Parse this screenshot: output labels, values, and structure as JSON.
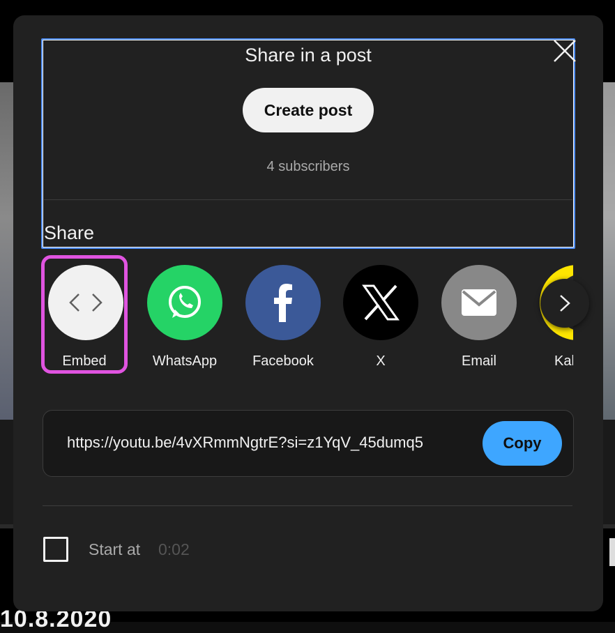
{
  "background": {
    "date_fragment": "10.8.2020"
  },
  "dialog": {
    "post_section": {
      "title": "Share in a post",
      "create_post_label": "Create post",
      "subscribers": "4 subscribers"
    },
    "share_heading": "Share",
    "share_targets": [
      {
        "label": "Embed",
        "icon": "embed-code-icon",
        "color": "#f1f1f1",
        "selected": true
      },
      {
        "label": "WhatsApp",
        "icon": "whatsapp-icon",
        "color": "#25d366"
      },
      {
        "label": "Facebook",
        "icon": "facebook-icon",
        "color": "#3b5998"
      },
      {
        "label": "X",
        "icon": "x-icon",
        "color": "#000000"
      },
      {
        "label": "Email",
        "icon": "email-icon",
        "color": "#888888"
      },
      {
        "label": "Kaka",
        "icon": "kakaotalk-icon",
        "color": "#fee500"
      }
    ],
    "next_icon": "chevron-right-icon",
    "close_icon": "close-icon",
    "link": {
      "url": "https://youtu.be/4vXRmmNgtrE?si=z1YqV_45dumq5",
      "copy_label": "Copy"
    },
    "start_at": {
      "label": "Start at",
      "time": "0:02",
      "checked": false
    }
  },
  "colors": {
    "dialog_bg": "#212121",
    "accent_blue": "#3ea6ff",
    "highlight_magenta": "#e054e0",
    "focus_blue": "#4f8ef7"
  }
}
